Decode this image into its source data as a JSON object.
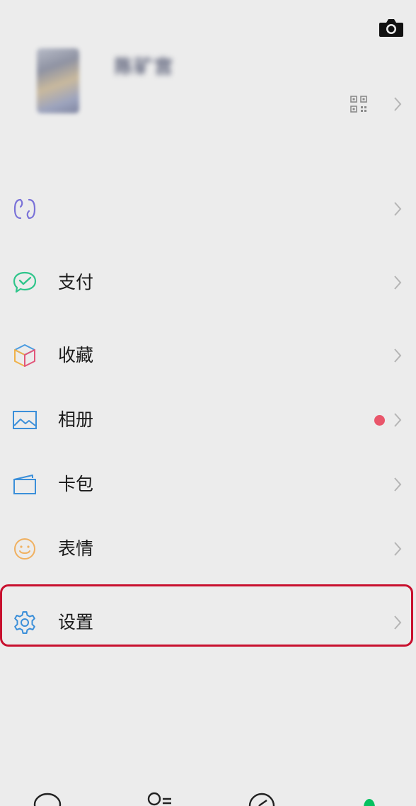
{
  "profile": {
    "nickname": "陈矿宫",
    "camera_icon": "camera-icon",
    "qr_icon": "qr-code-icon"
  },
  "menu": [
    {
      "key": "services",
      "label": "",
      "icon": "services-icon",
      "badge": false
    },
    {
      "key": "pay",
      "label": "支付",
      "icon": "pay-icon",
      "badge": false
    },
    {
      "key": "favorites",
      "label": "收藏",
      "icon": "favorites-cube-icon",
      "badge": false
    },
    {
      "key": "album",
      "label": "相册",
      "icon": "album-image-icon",
      "badge": true
    },
    {
      "key": "cards",
      "label": "卡包",
      "icon": "card-wallet-icon",
      "badge": false
    },
    {
      "key": "stickers",
      "label": "表情",
      "icon": "smiley-icon",
      "badge": false
    },
    {
      "key": "settings",
      "label": "设置",
      "icon": "gear-icon",
      "badge": false
    }
  ],
  "colors": {
    "background": "#ececec",
    "badge": "#e9566b",
    "highlight": "#c8102e",
    "pay_green": "#2fc58b",
    "album_blue": "#3b8fd9",
    "settings_blue": "#3b8fd9",
    "stickers_orange": "#f0b060",
    "services_purple": "#7a72d8",
    "active_tab": "#07c160"
  },
  "tabbar": [
    {
      "key": "chats",
      "icon": "chat-bubble-icon"
    },
    {
      "key": "contacts",
      "icon": "contacts-icon"
    },
    {
      "key": "discover",
      "icon": "compass-icon"
    },
    {
      "key": "me",
      "icon": "person-icon",
      "active": true
    }
  ]
}
